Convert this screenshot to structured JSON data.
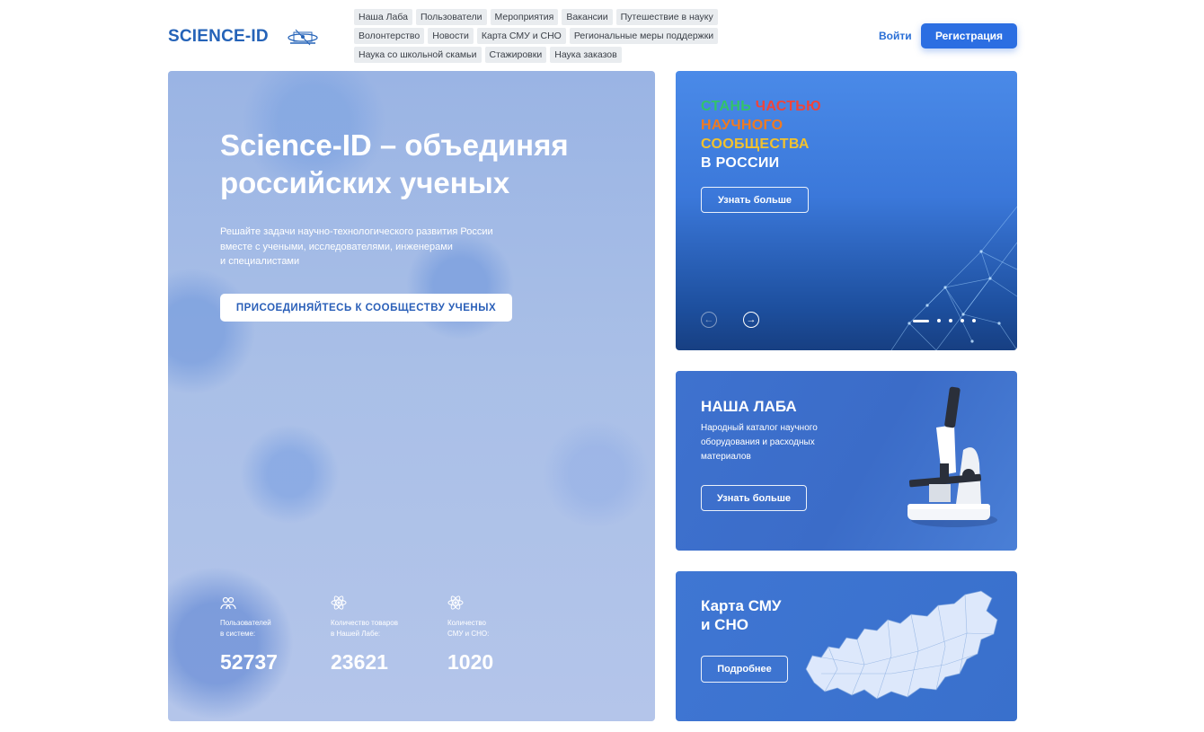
{
  "header": {
    "logo_text": "SCIENCE-ID",
    "nav": [
      "Наша Лаба",
      "Пользователи",
      "Мероприятия",
      "Вакансии",
      "Путешествие в науку",
      "Волонтерство",
      "Новости",
      "Карта СМУ и СНО",
      "Региональные меры поддержки",
      "Наука со школьной скамьи",
      "Стажировки",
      "Наука заказов"
    ],
    "login_label": "Войти",
    "register_label": "Регистрация"
  },
  "hero": {
    "title": "Science-ID – объединяя российских ученых",
    "subtitle_lines": [
      "Решайте задачи научно-технологического развития России",
      "вместе с учеными, исследователями, инженерами",
      "и специалистами"
    ],
    "cta_label": "ПРИСОЕДИНЯЙТЕСЬ К СООБЩЕСТВУ УЧЕНЫХ",
    "stats": [
      {
        "label_lines": [
          "Пользователей",
          "в системе:"
        ],
        "value": "52737",
        "icon": "users-icon"
      },
      {
        "label_lines": [
          "Количество товаров",
          "в Нашей Лабе:"
        ],
        "value": "23621",
        "icon": "atom-icon"
      },
      {
        "label_lines": [
          "Количество",
          "СМУ и СНО:"
        ],
        "value": "1020",
        "icon": "atom-icon"
      }
    ]
  },
  "banner": {
    "slogan_lines": [
      {
        "parts": [
          {
            "text": "СТАНЬ",
            "color": "#33c36b"
          },
          {
            "text": "ЧАСТЬЮ",
            "color": "#f0443a"
          }
        ]
      },
      {
        "parts": [
          {
            "text": "НАУЧНОГО",
            "color": "#f07a21"
          }
        ]
      },
      {
        "parts": [
          {
            "text": "СООБЩЕСТВА",
            "color": "#f3c22d"
          }
        ]
      },
      {
        "parts": [
          {
            "text": "В РОССИИ",
            "color": "#ffffff"
          }
        ]
      }
    ],
    "button_label": "Узнать больше",
    "prev_icon": "arrow-left-icon",
    "next_icon": "arrow-right-icon",
    "slides_total": 5,
    "active_slide": 1
  },
  "lab_card": {
    "title": "НАША ЛАБА",
    "description": "Народный каталог научного оборудования и расходных материалов",
    "button_label": "Узнать больше",
    "icon": "microscope-icon"
  },
  "map_card": {
    "title_lines": [
      "Карта СМУ",
      "и СНО"
    ],
    "button_label": "Подробнее",
    "icon": "russia-map-icon"
  },
  "colors": {
    "accent": "#2b6ee2",
    "logo": "#2563b8",
    "nav_bg": "#e9ecef"
  }
}
